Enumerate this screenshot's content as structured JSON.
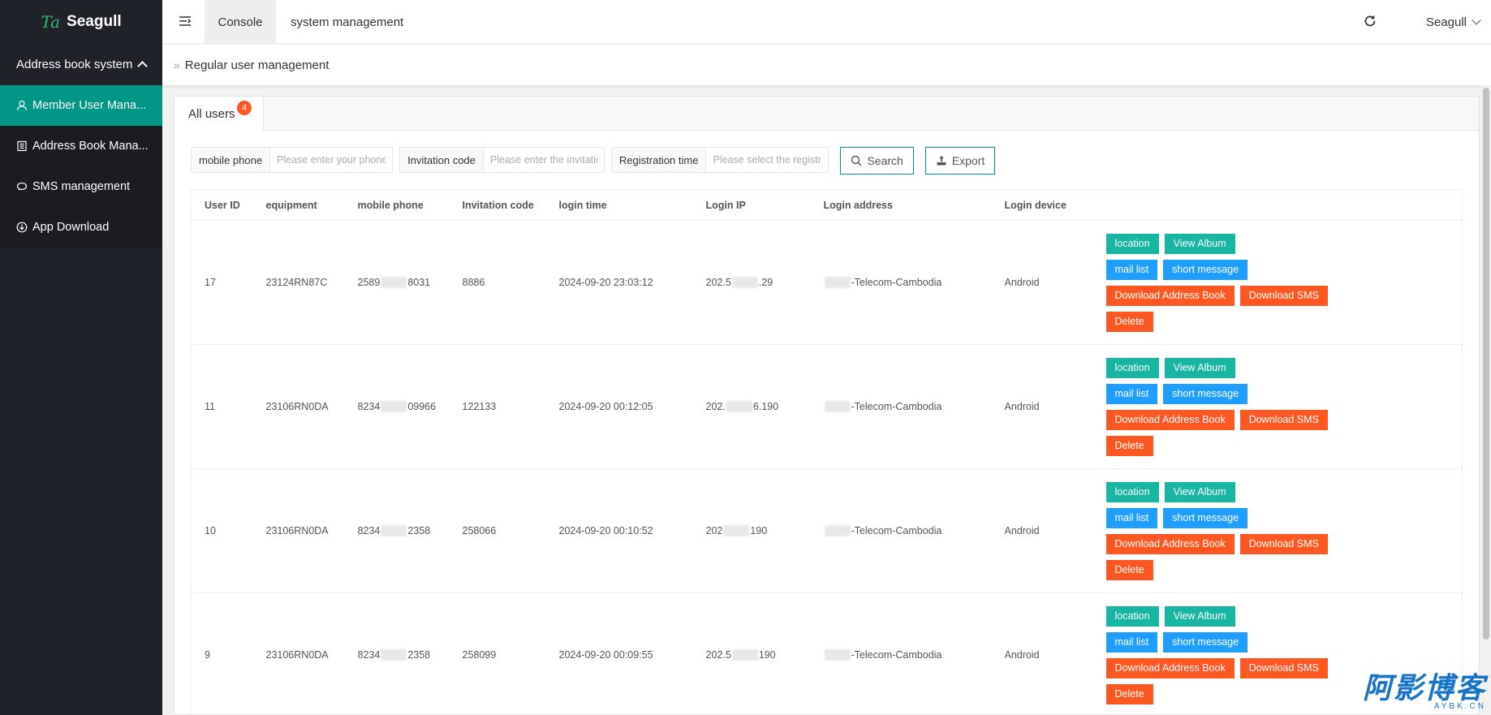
{
  "app": {
    "logo_mark": "Ta",
    "name": "Seagull"
  },
  "sidebar": {
    "group_label": "Address book system",
    "items": [
      {
        "label": "Member User Mana...",
        "icon": "user-icon",
        "active": true
      },
      {
        "label": "Address Book Mana...",
        "icon": "book-icon",
        "active": false
      },
      {
        "label": "SMS management",
        "icon": "message-icon",
        "active": false
      },
      {
        "label": "App Download",
        "icon": "download-icon",
        "active": false
      }
    ]
  },
  "header": {
    "tabs": [
      {
        "label": "Console",
        "active": true
      },
      {
        "label": "system management",
        "active": false
      }
    ],
    "user": "Seagull"
  },
  "breadcrumb": {
    "current": "Regular user management"
  },
  "panel": {
    "tab_label": "All users",
    "badge": "4"
  },
  "filters": {
    "phone": {
      "label": "mobile phone",
      "placeholder": "Please enter your phone"
    },
    "invite": {
      "label": "Invitation code",
      "placeholder": "Please enter the invitatio"
    },
    "reg": {
      "label": "Registration time",
      "placeholder": "Please select the registr"
    },
    "search_label": "Search",
    "export_label": "Export"
  },
  "table": {
    "headers": [
      "User ID",
      "equipment",
      "mobile phone",
      "Invitation code",
      "login time",
      "Login IP",
      "Login address",
      "Login device"
    ],
    "rows": [
      {
        "id": "17",
        "equipment": "23124RN87C",
        "phone_a": "2589",
        "phone_b": "8031",
        "invite": "8886",
        "time": "2024-09-20 23:03:12",
        "ip_a": "202.5",
        "ip_b": ".29",
        "addr": "-Telecom-Cambodia",
        "device": "Android"
      },
      {
        "id": "11",
        "equipment": "23106RN0DA",
        "phone_a": "8234",
        "phone_b": "09966",
        "invite": "122133",
        "time": "2024-09-20 00:12:05",
        "ip_a": "202.",
        "ip_b": "6.190",
        "addr": "-Telecom-Cambodia",
        "device": "Android"
      },
      {
        "id": "10",
        "equipment": "23106RN0DA",
        "phone_a": "8234",
        "phone_b": "2358",
        "invite": "258066",
        "time": "2024-09-20 00:10:52",
        "ip_a": "202",
        "ip_b": "190",
        "addr": "-Telecom-Cambodia",
        "device": "Android"
      },
      {
        "id": "9",
        "equipment": "23106RN0DA",
        "phone_a": "8234",
        "phone_b": "2358",
        "invite": "258099",
        "time": "2024-09-20 00:09:55",
        "ip_a": "202.5",
        "ip_b": "190",
        "addr": "-Telecom-Cambodia",
        "device": "Android"
      }
    ],
    "actions": {
      "location": "location",
      "view_album": "View Album",
      "mail_list": "mail list",
      "short_message": "short message",
      "download_book": "Download Address Book",
      "download_sms": "Download SMS",
      "delete": "Delete"
    }
  },
  "watermark": {
    "big": "阿影博客",
    "small": "AYBK.CN"
  }
}
